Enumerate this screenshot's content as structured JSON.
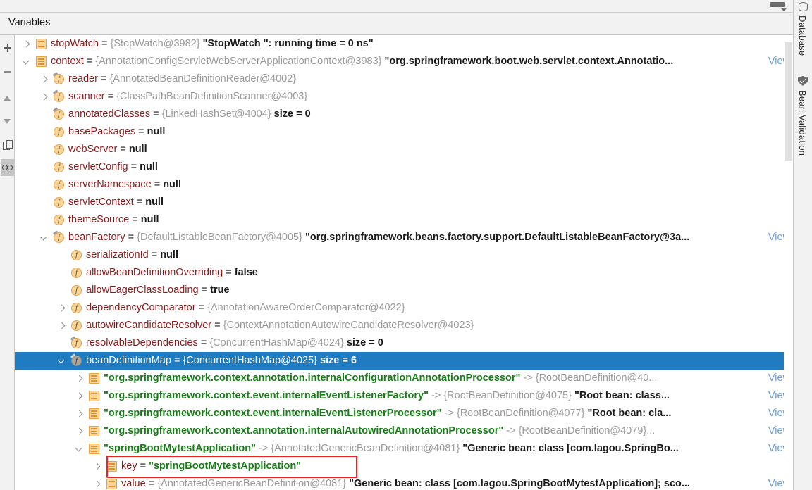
{
  "window": {
    "title": "Variables",
    "settings_icon": "toolbar-settings-dropdown-icon"
  },
  "left_toolbar": {
    "buttons": [
      {
        "name": "add-watch",
        "icon": "plus-icon",
        "active": false
      },
      {
        "name": "remove-watch",
        "icon": "minus-icon",
        "active": false
      },
      {
        "name": "move-up",
        "icon": "arrow-up-icon",
        "active": false
      },
      {
        "name": "move-down",
        "icon": "arrow-down-icon",
        "active": false
      },
      {
        "name": "copy-value",
        "icon": "copy-icon",
        "active": false
      },
      {
        "name": "inspect-watches",
        "icon": "glasses-icon",
        "active": true
      }
    ]
  },
  "right_bar": {
    "tabs": [
      {
        "label": "Database",
        "icon": "database-icon"
      },
      {
        "label": "Bean Validation",
        "icon": "bean-validation-shield-icon"
      }
    ]
  },
  "links": {
    "view": "View"
  },
  "tree": {
    "rows": [
      {
        "indent": 0,
        "arrow": "collapsed",
        "icon": "list",
        "name": "stopWatch",
        "eq": "=",
        "type": "{StopWatch@3982}",
        "value": "\"StopWatch '': running time = 0 ns\"",
        "value_kind": "plain",
        "view": false
      },
      {
        "indent": 0,
        "arrow": "expanded",
        "icon": "list",
        "name": "context",
        "eq": "=",
        "type": "{AnnotationConfigServletWebServerApplicationContext@3983}",
        "value": "\"org.springframework.boot.web.servlet.context.Annotatio...",
        "value_kind": "plain",
        "view": true
      },
      {
        "indent": 1,
        "arrow": "collapsed",
        "icon": "field-private",
        "name": "reader",
        "eq": "=",
        "type": "{AnnotatedBeanDefinitionReader@4002}",
        "value": "",
        "value_kind": "plain",
        "view": false
      },
      {
        "indent": 1,
        "arrow": "collapsed",
        "icon": "field-private",
        "name": "scanner",
        "eq": "=",
        "type": "{ClassPathBeanDefinitionScanner@4003}",
        "value": "",
        "value_kind": "plain",
        "view": false
      },
      {
        "indent": 1,
        "arrow": "none",
        "icon": "field-private",
        "name": "annotatedClasses",
        "eq": "=",
        "type": "{LinkedHashSet@4004}",
        "value": "size = 0",
        "value_kind": "plain",
        "view": false
      },
      {
        "indent": 1,
        "arrow": "none",
        "icon": "field",
        "name": "basePackages",
        "eq": "=",
        "type": "",
        "value": "null",
        "value_kind": "plain",
        "view": false
      },
      {
        "indent": 1,
        "arrow": "none",
        "icon": "field",
        "name": "webServer",
        "eq": "=",
        "type": "",
        "value": "null",
        "value_kind": "plain",
        "view": false
      },
      {
        "indent": 1,
        "arrow": "none",
        "icon": "field",
        "name": "servletConfig",
        "eq": "=",
        "type": "",
        "value": "null",
        "value_kind": "plain",
        "view": false
      },
      {
        "indent": 1,
        "arrow": "none",
        "icon": "field",
        "name": "serverNamespace",
        "eq": "=",
        "type": "",
        "value": "null",
        "value_kind": "plain",
        "view": false
      },
      {
        "indent": 1,
        "arrow": "none",
        "icon": "field",
        "name": "servletContext",
        "eq": "=",
        "type": "",
        "value": "null",
        "value_kind": "plain",
        "view": false
      },
      {
        "indent": 1,
        "arrow": "none",
        "icon": "field",
        "name": "themeSource",
        "eq": "=",
        "type": "",
        "value": "null",
        "value_kind": "plain",
        "view": false
      },
      {
        "indent": 1,
        "arrow": "expanded",
        "icon": "field-private",
        "name": "beanFactory",
        "eq": "=",
        "type": "{DefaultListableBeanFactory@4005}",
        "value": "\"org.springframework.beans.factory.support.DefaultListableBeanFactory@3a...",
        "value_kind": "plain",
        "view": true
      },
      {
        "indent": 2,
        "arrow": "none",
        "icon": "field",
        "name": "serializationId",
        "eq": "=",
        "type": "",
        "value": "null",
        "value_kind": "plain",
        "view": false
      },
      {
        "indent": 2,
        "arrow": "none",
        "icon": "field",
        "name": "allowBeanDefinitionOverriding",
        "eq": "=",
        "type": "",
        "value": "false",
        "value_kind": "plain",
        "view": false
      },
      {
        "indent": 2,
        "arrow": "none",
        "icon": "field",
        "name": "allowEagerClassLoading",
        "eq": "=",
        "type": "",
        "value": "true",
        "value_kind": "plain",
        "view": false
      },
      {
        "indent": 2,
        "arrow": "collapsed",
        "icon": "field",
        "name": "dependencyComparator",
        "eq": "=",
        "type": "{AnnotationAwareOrderComparator@4022}",
        "value": "",
        "value_kind": "plain",
        "view": false
      },
      {
        "indent": 2,
        "arrow": "collapsed",
        "icon": "field",
        "name": "autowireCandidateResolver",
        "eq": "=",
        "type": "{ContextAnnotationAutowireCandidateResolver@4023}",
        "value": "",
        "value_kind": "plain",
        "view": false
      },
      {
        "indent": 2,
        "arrow": "none",
        "icon": "field-private",
        "name": "resolvableDependencies",
        "eq": "=",
        "type": "{ConcurrentHashMap@4024}",
        "value": "size = 0",
        "value_kind": "plain",
        "view": false
      },
      {
        "indent": 2,
        "arrow": "expanded",
        "icon": "field-private",
        "name": "beanDefinitionMap",
        "eq": "=",
        "type": "{ConcurrentHashMap@4025}",
        "value": "size = 6",
        "value_kind": "plain",
        "view": false,
        "selected": true
      },
      {
        "indent": 3,
        "arrow": "collapsed",
        "icon": "list",
        "name": "\"org.springframework.context.annotation.internalConfigurationAnnotationProcessor\"",
        "name_kind": "string",
        "eq": "->",
        "type": "{RootBeanDefinition@40...",
        "value": "",
        "value_kind": "plain",
        "view": true
      },
      {
        "indent": 3,
        "arrow": "collapsed",
        "icon": "list",
        "name": "\"org.springframework.context.event.internalEventListenerFactory\"",
        "name_kind": "string",
        "eq": "->",
        "type": "{RootBeanDefinition@4075}",
        "value": "\"Root bean: class...",
        "value_kind": "plain",
        "view": true
      },
      {
        "indent": 3,
        "arrow": "collapsed",
        "icon": "list",
        "name": "\"org.springframework.context.event.internalEventListenerProcessor\"",
        "name_kind": "string",
        "eq": "->",
        "type": "{RootBeanDefinition@4077}",
        "value": "\"Root bean: cla...",
        "value_kind": "plain",
        "view": true
      },
      {
        "indent": 3,
        "arrow": "collapsed",
        "icon": "list",
        "name": "\"org.springframework.context.annotation.internalAutowiredAnnotationProcessor\"",
        "name_kind": "string",
        "eq": "->",
        "type": "{RootBeanDefinition@4079}...",
        "value": "",
        "value_kind": "plain",
        "view": true
      },
      {
        "indent": 3,
        "arrow": "expanded",
        "icon": "list",
        "name": "\"springBootMytestApplication\"",
        "name_kind": "string",
        "eq": "->",
        "type": "{AnnotatedGenericBeanDefinition@4081}",
        "value": "\"Generic bean: class [com.lagou.SpringBo...",
        "value_kind": "plain",
        "view": true
      },
      {
        "indent": 4,
        "arrow": "collapsed",
        "icon": "list",
        "name": "key",
        "eq": "=",
        "type": "",
        "value": "\"springBootMytestApplication\"",
        "value_kind": "string",
        "view": false,
        "annotated": true
      },
      {
        "indent": 4,
        "arrow": "collapsed",
        "icon": "list",
        "name": "value",
        "eq": "=",
        "type": "{AnnotatedGenericBeanDefinition@4081}",
        "value": "\"Generic bean: class [com.lagou.SpringBootMytestApplication]; sco...",
        "value_kind": "plain",
        "view": true
      }
    ]
  },
  "annotation": {
    "type": "red-rectangle-highlight",
    "target_label": "key = \"springBootMytestApplication\"",
    "color": "#f02020"
  },
  "scrollbar": {
    "orientation": "vertical",
    "position_percent": 2
  }
}
